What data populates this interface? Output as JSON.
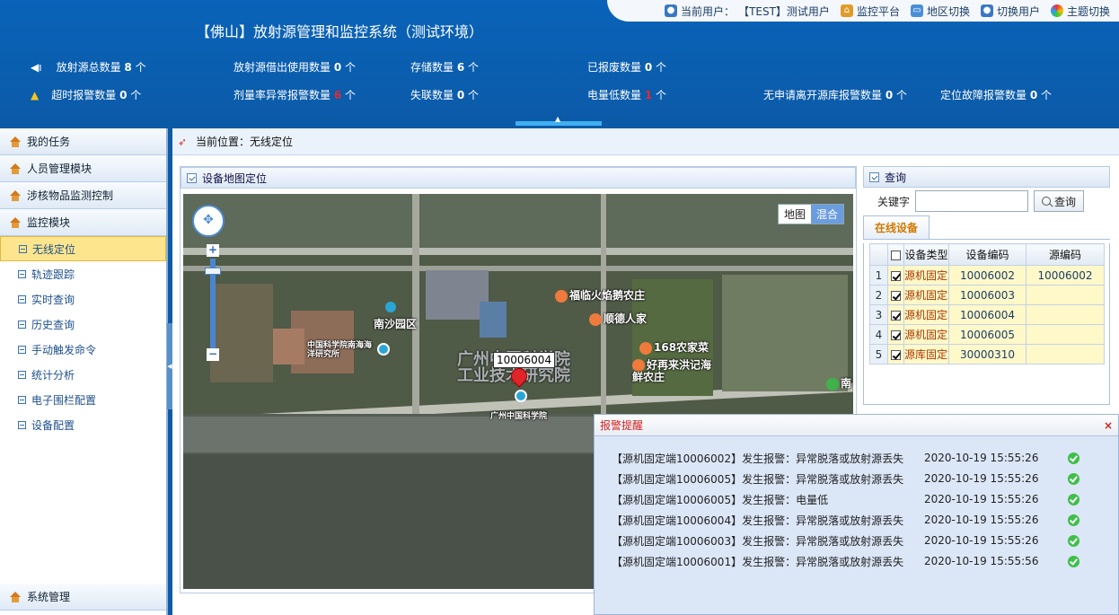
{
  "header": {
    "title": "【佛山】放射源管理和监控系统（测试环境）",
    "current_user_label": "当前用户：",
    "current_user": "【TEST】测试用户",
    "links": [
      "监控平台",
      "地区切换",
      "切换用户",
      "主题切换"
    ]
  },
  "stats": {
    "row1": [
      {
        "label": "放射源总数量",
        "value": "8",
        "unit": "个"
      },
      {
        "label": "放射源借出使用数量",
        "value": "0",
        "unit": "个"
      },
      {
        "label": "存储数量",
        "value": "6",
        "unit": "个"
      },
      {
        "label": "已报废数量",
        "value": "0",
        "unit": "个"
      }
    ],
    "row2": [
      {
        "label": "超时报警数量",
        "value": "0",
        "unit": "个"
      },
      {
        "label": "剂量率异常报警数量",
        "value": "6",
        "unit": "个"
      },
      {
        "label": "失联数量",
        "value": "0",
        "unit": "个"
      },
      {
        "label": "电量低数量",
        "value": "1",
        "unit": "个"
      },
      {
        "label": "无申请离开源库报警数量",
        "value": "0",
        "unit": "个"
      },
      {
        "label": "定位故障报警数量",
        "value": "0",
        "unit": "个"
      }
    ]
  },
  "sidebar": {
    "groups": [
      "我的任务",
      "人员管理模块",
      "涉核物品监测控制",
      "监控模块"
    ],
    "items": [
      "无线定位",
      "轨迹跟踪",
      "实时查询",
      "历史查询",
      "手动触发命令",
      "统计分析",
      "电子围栏配置",
      "设备配置"
    ],
    "bottom": "系统管理"
  },
  "breadcrumb": "当前位置：无线定位",
  "map_panel": {
    "title": "设备地图定位",
    "type_buttons": [
      "地图",
      "混合"
    ],
    "marker_label": "10006004",
    "pois": [
      "南沙园区",
      "中国科学院南海海洋研究所",
      "广州中国科学院",
      "福临火焰鹅农庄",
      "顺德人家",
      "168农家菜",
      "好再来洪记海鲜农庄",
      "南"
    ],
    "watermarks": [
      "广州中国科学院",
      "工业技术研究院"
    ]
  },
  "query_panel": {
    "title": "查询",
    "keyword_label": "关键字",
    "keyword_value": "",
    "search_button": "查询",
    "tab": "在线设备",
    "columns": [
      "设备类型",
      "设备编码",
      "源编码"
    ],
    "rows": [
      {
        "n": "1",
        "type": "源机固定端",
        "code": "10006002",
        "source": "10006002",
        "checked": true
      },
      {
        "n": "2",
        "type": "源机固定端",
        "code": "10006003",
        "source": "",
        "checked": true
      },
      {
        "n": "3",
        "type": "源机固定端",
        "code": "10006004",
        "source": "",
        "checked": true
      },
      {
        "n": "4",
        "type": "源机固定端",
        "code": "10006005",
        "source": "",
        "checked": true
      },
      {
        "n": "5",
        "type": "源库固定端",
        "code": "30000310",
        "source": "",
        "checked": true
      }
    ]
  },
  "alarm": {
    "title": "报警提醒",
    "close": "×",
    "items": [
      {
        "msg": "【源机固定端10006002】发生报警：异常脱落或放射源丢失",
        "time": "2020-10-19 15:55:26"
      },
      {
        "msg": "【源机固定端10006005】发生报警：异常脱落或放射源丢失",
        "time": "2020-10-19 15:55:26"
      },
      {
        "msg": "【源机固定端10006005】发生报警：电量低",
        "time": "2020-10-19 15:55:26"
      },
      {
        "msg": "【源机固定端10006004】发生报警：异常脱落或放射源丢失",
        "time": "2020-10-19 15:55:26"
      },
      {
        "msg": "【源机固定端10006003】发生报警：异常脱落或放射源丢失",
        "time": "2020-10-19 15:55:26"
      },
      {
        "msg": "【源机固定端10006001】发生报警：异常脱落或放射源丢失",
        "time": "2020-10-19 15:55:56"
      }
    ]
  }
}
